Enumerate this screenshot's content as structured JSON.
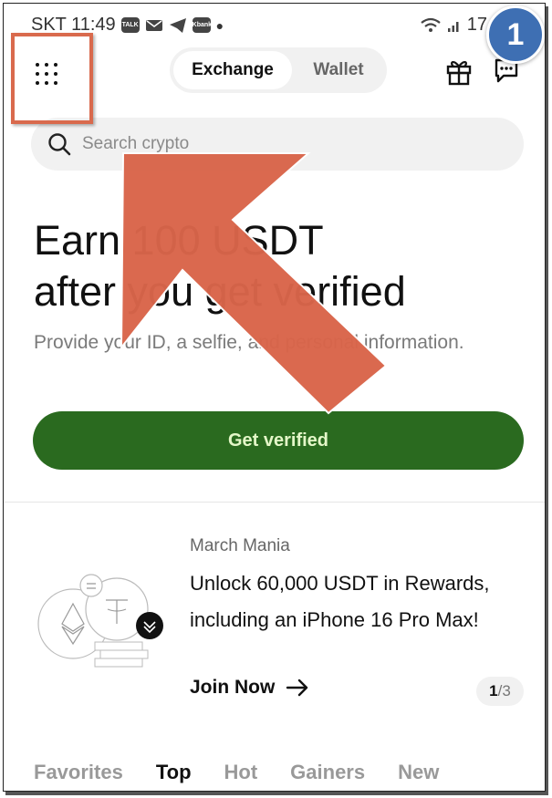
{
  "status_bar": {
    "carrier_time": "SKT 11:49",
    "apps": [
      "TALK",
      "Kbank"
    ],
    "battery": "17"
  },
  "step_badge": "1",
  "header": {
    "tabs": [
      {
        "label": "Exchange",
        "active": true
      },
      {
        "label": "Wallet",
        "active": false
      }
    ]
  },
  "search": {
    "placeholder": "Search crypto"
  },
  "hero": {
    "title_line1": "Earn 100 USDT",
    "title_line2": "after you get verified",
    "subtitle": "Provide your ID, a selfie, and personal information.",
    "cta_label": "Get verified"
  },
  "promo": {
    "tag": "March Mania",
    "text": "Unlock 60,000 USDT in Rewards, including an iPhone 16 Pro Max!",
    "action_label": "Join Now",
    "page_current": "1",
    "page_total": "/3"
  },
  "market_tabs": [
    {
      "label": "Favorites",
      "active": false
    },
    {
      "label": "Top",
      "active": true
    },
    {
      "label": "Hot",
      "active": false
    },
    {
      "label": "Gainers",
      "active": false
    },
    {
      "label": "New",
      "active": false
    }
  ],
  "colors": {
    "accent_green": "#2a6a1f",
    "cta_text": "#e4f7c8",
    "annotation": "#d96a4d",
    "badge_blue": "#3e6fb3"
  }
}
